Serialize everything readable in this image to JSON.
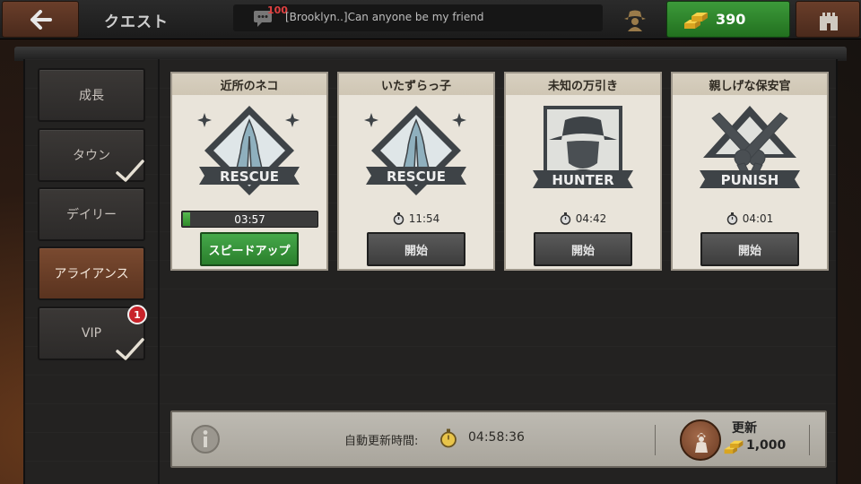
{
  "header": {
    "title": "クエスト",
    "chat_unread": "100",
    "chat_message": "[Brooklyn..]Can anyone be my friend",
    "gold": "390"
  },
  "sidebar": {
    "items": [
      {
        "label": "成長",
        "active": false,
        "completed": false
      },
      {
        "label": "タウン",
        "active": false,
        "completed": true
      },
      {
        "label": "デイリー",
        "active": false,
        "completed": false
      },
      {
        "label": "アライアンス",
        "active": true,
        "completed": false
      },
      {
        "label": "VIP",
        "active": false,
        "completed": true,
        "badge": "1"
      }
    ]
  },
  "quests": [
    {
      "title": "近所のネコ",
      "emblem_text": "RESCUE",
      "emblem_icon": "praying-hands-icon",
      "timer": "03:57",
      "progress": 0.05,
      "button": "スピードアップ",
      "button_style": "green"
    },
    {
      "title": "いたずらっ子",
      "emblem_text": "RESCUE",
      "emblem_icon": "praying-hands-icon",
      "timer": "11:54",
      "button": "開始",
      "button_style": "gray"
    },
    {
      "title": "未知の万引き",
      "emblem_text": "HUNTER",
      "emblem_icon": "cowboy-portrait-icon",
      "timer": "04:42",
      "button": "開始",
      "button_style": "gray"
    },
    {
      "title": "親しげな保安官",
      "emblem_text": "PUNISH",
      "emblem_icon": "crossed-revolvers-icon",
      "timer": "04:01",
      "button": "開始",
      "button_style": "gray"
    }
  ],
  "footer": {
    "auto_refresh_label": "自動更新時間:",
    "auto_refresh_time": "04:58:36",
    "refresh_label": "更新",
    "refresh_cost": "1,000"
  },
  "colors": {
    "accent_green": "#2f8a2a",
    "active_tab": "#7a4a30",
    "badge_red": "#c8232a"
  }
}
